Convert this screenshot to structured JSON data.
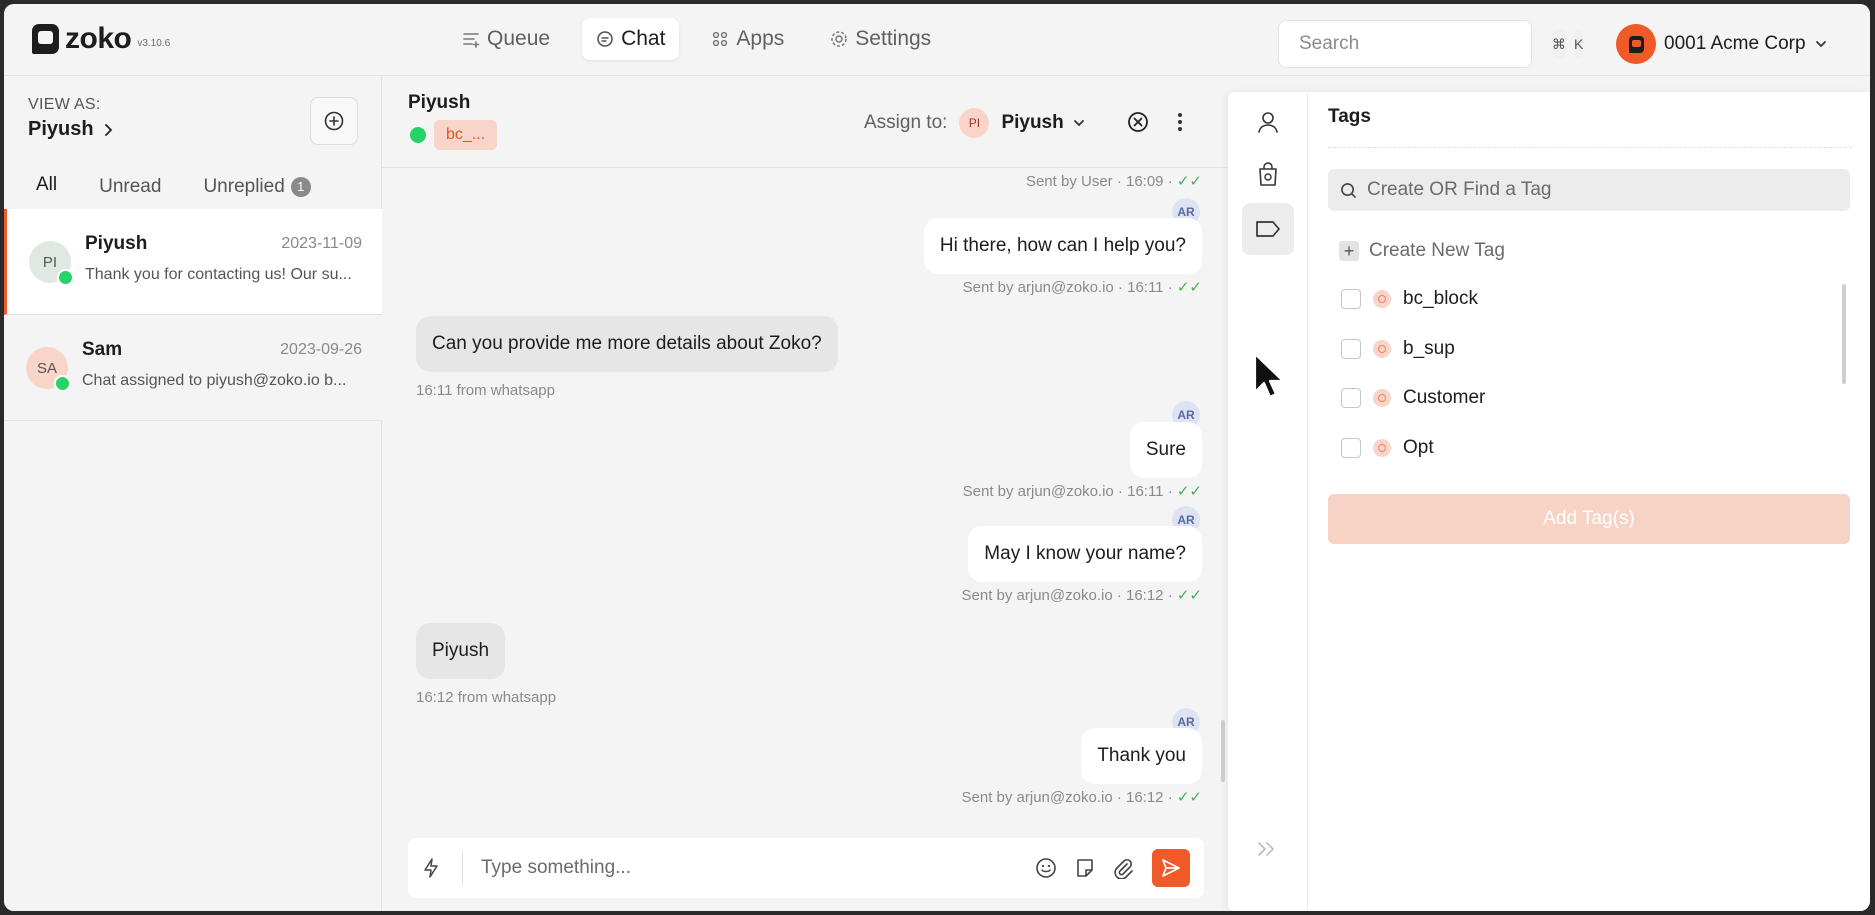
{
  "app": {
    "logo_text": "zoko",
    "version": "v3.10.6"
  },
  "nav": {
    "items": [
      {
        "label": "Queue",
        "icon": "queue-icon"
      },
      {
        "label": "Chat",
        "icon": "chat-icon",
        "active": true
      },
      {
        "label": "Apps",
        "icon": "apps-icon"
      },
      {
        "label": "Settings",
        "icon": "settings-icon"
      }
    ]
  },
  "search": {
    "placeholder": "Search",
    "shortcut_keys": [
      "⌘",
      "K"
    ]
  },
  "account": {
    "name": "0001 Acme Corp"
  },
  "sidebar": {
    "view_as_label": "VIEW AS:",
    "view_as_user": "Piyush",
    "tabs": [
      {
        "label": "All",
        "active": true
      },
      {
        "label": "Unread"
      },
      {
        "label": "Unreplied",
        "badge": "1"
      }
    ],
    "chats": [
      {
        "initials": "PI",
        "name": "Piyush",
        "date": "2023-11-09",
        "preview": "Thank you for contacting us! Our su...",
        "avatar_color": "#dfe9e2",
        "active": true
      },
      {
        "initials": "SA",
        "name": "Sam",
        "date": "2023-09-26",
        "preview": "Chat assigned to piyush@zoko.io b...",
        "avatar_color": "#f9d4c8"
      }
    ]
  },
  "chat_header": {
    "name": "Piyush",
    "tag_chip": "bc_...",
    "assign_label": "Assign to:",
    "assignee_initials": "PI",
    "assignee_name": "Piyush"
  },
  "messages": [
    {
      "meta": "Sent by User · 16:09 · ✓✓"
    },
    {
      "direction": "out",
      "avatar": "AR",
      "text": "Hi there, how can I help you?",
      "meta": "Sent by arjun@zoko.io · 16:11 · ✓✓"
    },
    {
      "direction": "in",
      "text": "Can you provide me more details about Zoko?",
      "meta": "16:11 from whatsapp"
    },
    {
      "direction": "out",
      "avatar": "AR",
      "text": "Sure",
      "meta": "Sent by arjun@zoko.io · 16:11 · ✓✓"
    },
    {
      "direction": "out",
      "avatar": "AR",
      "text": "May I know your name?",
      "meta": "Sent by arjun@zoko.io · 16:12 · ✓✓"
    },
    {
      "direction": "in",
      "text": "Piyush",
      "meta": "16:12 from whatsapp"
    },
    {
      "direction": "out",
      "avatar": "AR",
      "text": "Thank you",
      "meta": "Sent by arjun@zoko.io · 16:12 · ✓✓"
    }
  ],
  "composer": {
    "placeholder": "Type something..."
  },
  "tags_panel": {
    "title": "Tags",
    "search_placeholder": "Create OR Find a Tag",
    "create_label": "Create New Tag",
    "tags": [
      {
        "label": "bc_block",
        "checked": false
      },
      {
        "label": "b_sup",
        "checked": false
      },
      {
        "label": "Customer",
        "checked": false
      },
      {
        "label": "Opt",
        "checked": false
      }
    ],
    "add_button_label": "Add Tag(s)"
  },
  "colors": {
    "accent": "#f05a28",
    "tag_bg": "#f9d4c8",
    "whatsapp": "#25d366"
  }
}
